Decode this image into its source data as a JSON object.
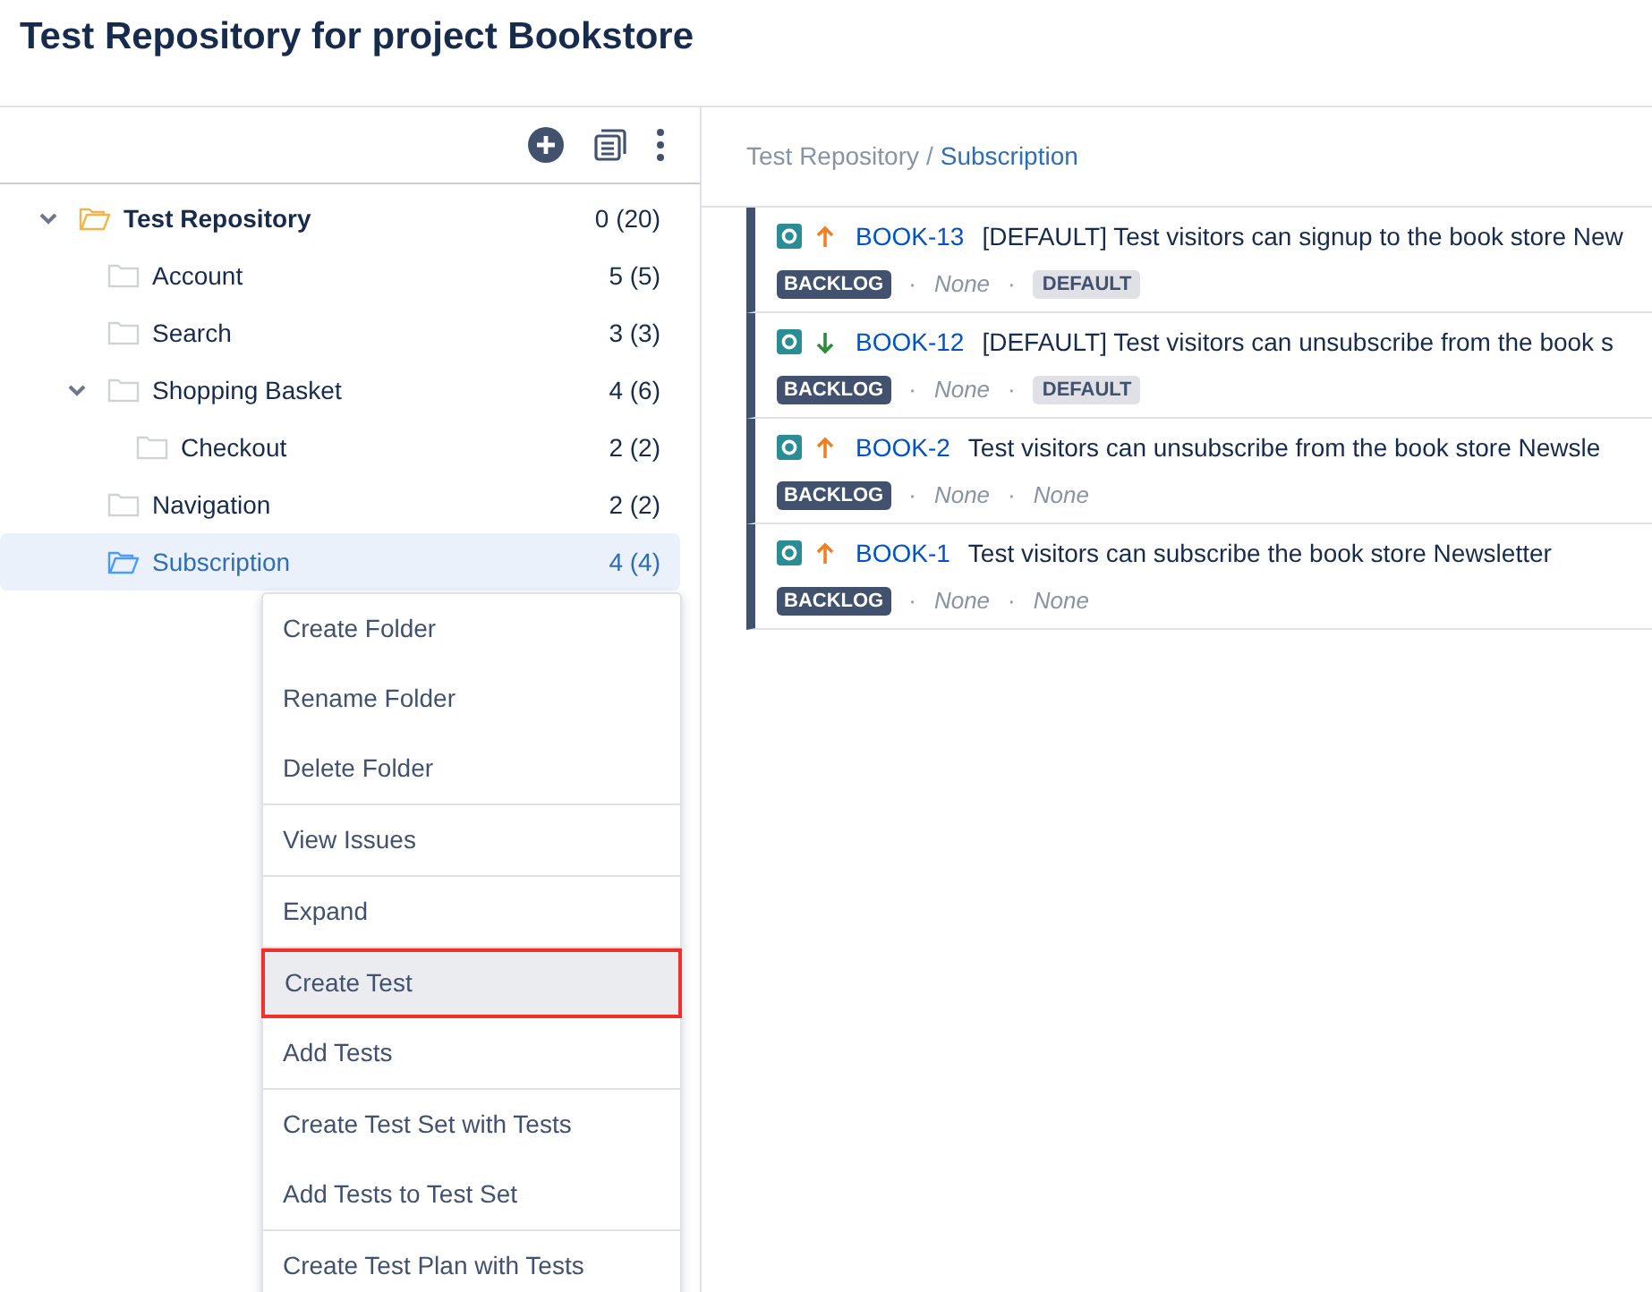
{
  "page_title": "Test Repository for project Bookstore",
  "tree": [
    {
      "label": "Test Repository",
      "count": "0 (20)",
      "expanded": true,
      "selected": false,
      "children": [
        {
          "label": "Account",
          "count": "5 (5)",
          "selected": false
        },
        {
          "label": "Search",
          "count": "3 (3)",
          "selected": false
        },
        {
          "label": "Shopping Basket",
          "count": "4 (6)",
          "expanded": true,
          "selected": false,
          "children": [
            {
              "label": "Checkout",
              "count": "2 (2)",
              "selected": false
            }
          ]
        },
        {
          "label": "Navigation",
          "count": "2 (2)",
          "selected": false
        },
        {
          "label": "Subscription",
          "count": "4 (4)",
          "selected": true
        }
      ]
    }
  ],
  "context_menu": [
    [
      {
        "label": "Create Folder",
        "selected": false
      },
      {
        "label": "Rename Folder",
        "selected": false
      },
      {
        "label": "Delete Folder",
        "selected": false
      }
    ],
    [
      {
        "label": "View Issues",
        "selected": false
      }
    ],
    [
      {
        "label": "Expand",
        "selected": false
      }
    ],
    [
      {
        "label": "Create Test",
        "selected": true
      },
      {
        "label": "Add Tests",
        "selected": false
      }
    ],
    [
      {
        "label": "Create Test Set with Tests",
        "selected": false
      },
      {
        "label": "Add Tests to Test Set",
        "selected": false
      }
    ],
    [
      {
        "label": "Create Test Plan with Tests",
        "selected": false
      }
    ]
  ],
  "breadcrumb": {
    "root": "Test Repository",
    "separator": "/",
    "current": "Subscription"
  },
  "issues": [
    {
      "key": "BOOK-13",
      "kind": "up",
      "summary": "[DEFAULT] Test visitors can signup to the book store New",
      "status": "BACKLOG",
      "sep": "·",
      "assignee": "None",
      "label": {
        "kind": "badge",
        "text": "DEFAULT"
      }
    },
    {
      "key": "BOOK-12",
      "kind": "down",
      "summary": "[DEFAULT] Test visitors can unsubscribe from the book s",
      "status": "BACKLOG",
      "sep": "·",
      "assignee": "None",
      "label": {
        "kind": "badge",
        "text": "DEFAULT"
      }
    },
    {
      "key": "BOOK-2",
      "kind": "up",
      "summary": "Test visitors can unsubscribe from the book store Newsle",
      "status": "BACKLOG",
      "sep": "·",
      "assignee": "None",
      "label": {
        "kind": "none",
        "text": "None"
      }
    },
    {
      "key": "BOOK-1",
      "kind": "up",
      "summary": "Test visitors can subscribe the book store Newsletter",
      "status": "BACKLOG",
      "sep": "·",
      "assignee": "None",
      "label": {
        "kind": "none",
        "text": "None"
      }
    }
  ]
}
